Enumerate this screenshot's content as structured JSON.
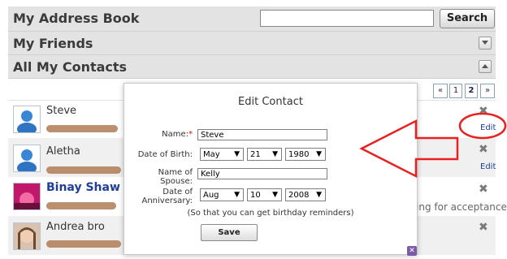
{
  "header": {
    "title": "My Address Book",
    "search_value": "",
    "search_button": "Search"
  },
  "sections": {
    "friends_title": "My Friends",
    "contacts_title": "All My Contacts"
  },
  "pager": {
    "prev": "«",
    "page1": "1",
    "page2": "2",
    "next": "»"
  },
  "contacts": [
    {
      "name": "Steve",
      "x": "✖",
      "edit": "Edit"
    },
    {
      "name": "Aletha",
      "x": "✖",
      "edit": "Edit"
    },
    {
      "name": "Binay Shaw",
      "x": "✖",
      "status": "ing for acceptance"
    },
    {
      "name": "Andrea bro",
      "x": "✖"
    }
  ],
  "dialog": {
    "title": "Edit Contact",
    "name_label": "Name:",
    "required_mark": "*",
    "name_value": "Steve",
    "dob_label": "Date of Birth:",
    "dob_month": "May",
    "dob_day": "21",
    "dob_year": "1980",
    "spouse_label_1": "Name of",
    "spouse_label_2": "Spouse:",
    "spouse_value": "Kelly",
    "anniv_label_1": "Date of",
    "anniv_label_2": "Anniversary:",
    "anniv_month": "Aug",
    "anniv_day": "10",
    "anniv_year": "2008",
    "hint": "(So that you can get birthday reminders)",
    "save_button": "Save",
    "close": "✕"
  },
  "colors": {
    "annotation": "#e8201f",
    "link": "#1f3f99",
    "bar": "#e3e3e3"
  }
}
